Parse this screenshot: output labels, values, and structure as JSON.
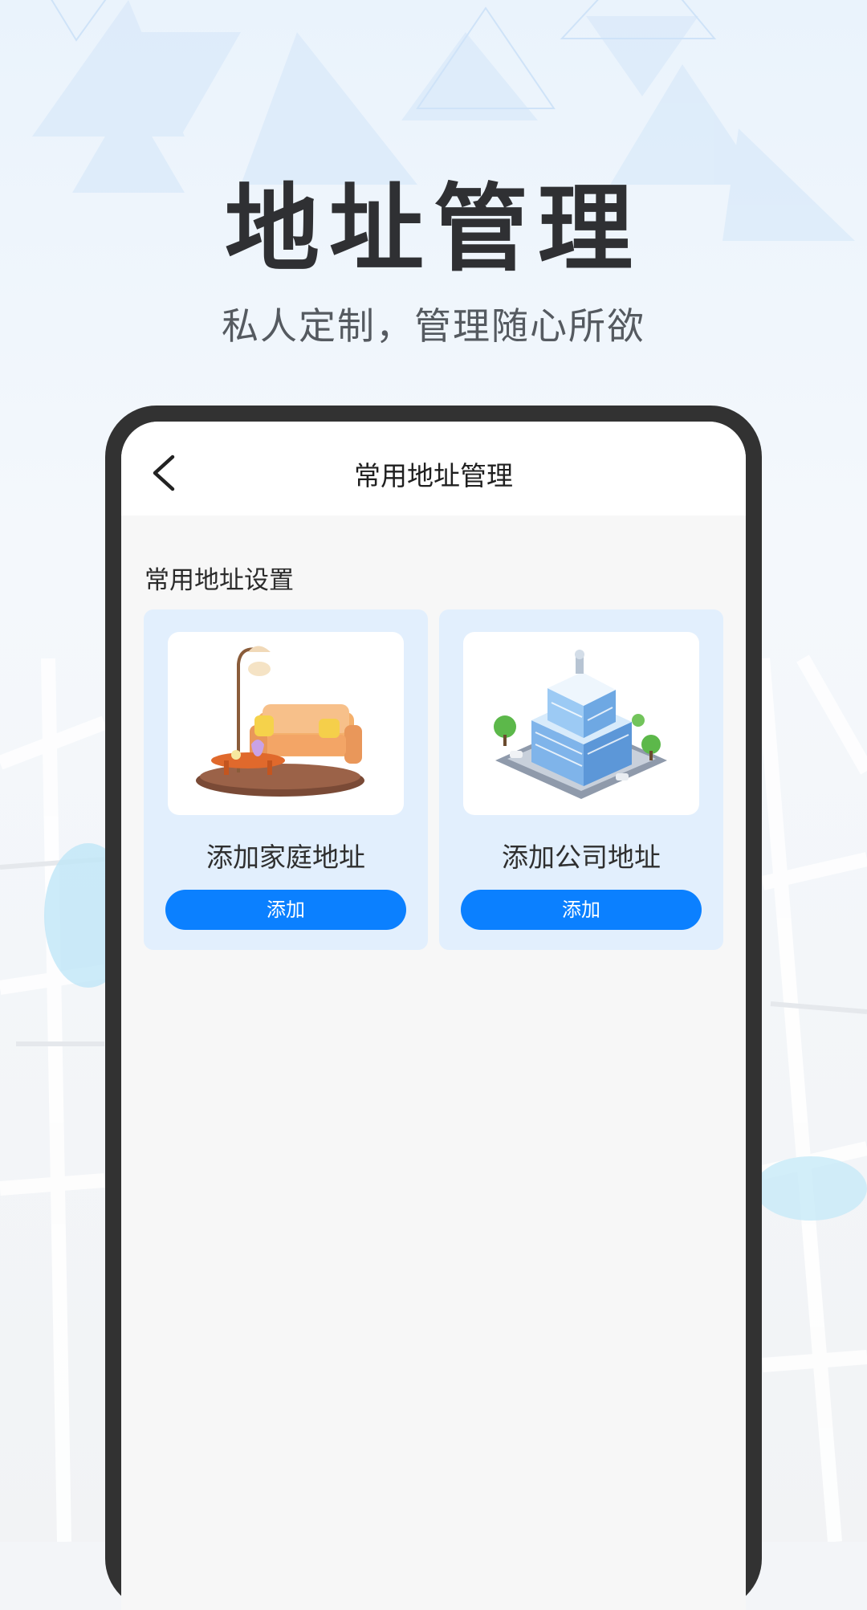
{
  "hero": {
    "title": "地址管理",
    "subtitle": "私人定制，管理随心所欲"
  },
  "app": {
    "nav_title": "常用地址管理",
    "section_title": "常用地址设置",
    "cards": [
      {
        "label": "添加家庭地址",
        "button": "添加",
        "icon": "sofa-illustration"
      },
      {
        "label": "添加公司地址",
        "button": "添加",
        "icon": "office-building-illustration"
      }
    ]
  },
  "colors": {
    "accent": "#0b80ff",
    "card_bg": "#e2effd",
    "phone_frame": "#323232",
    "title_text": "#2f3033"
  }
}
